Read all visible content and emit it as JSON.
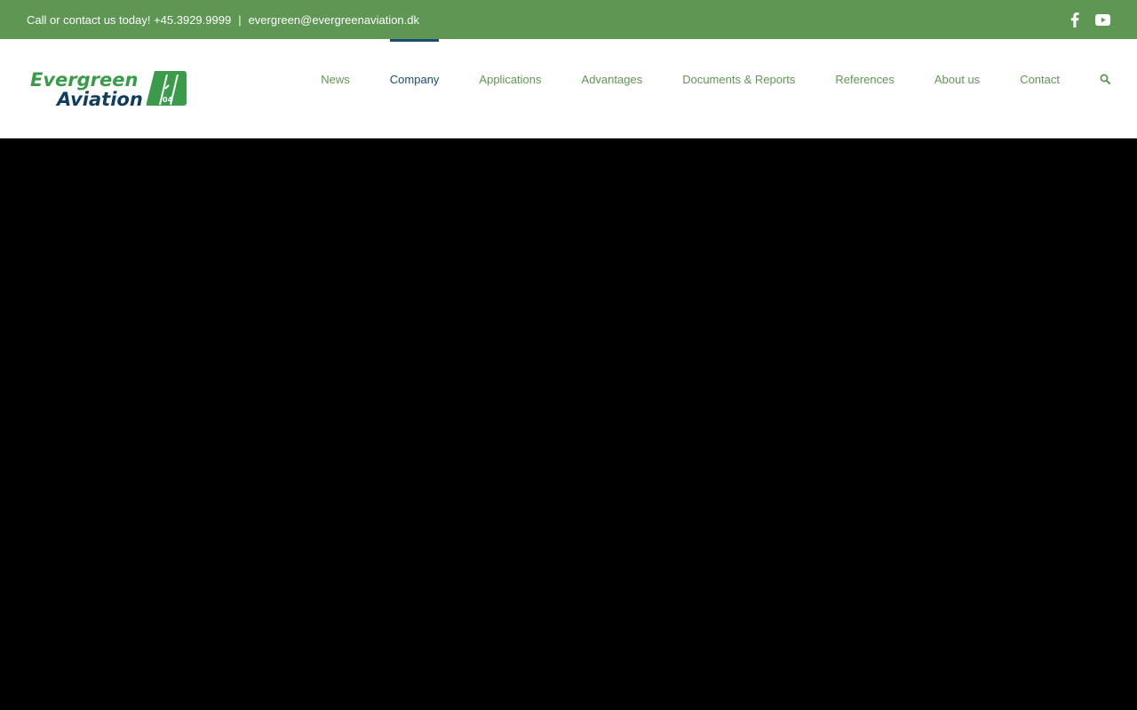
{
  "topbar": {
    "call_text": "Call or contact us today! +45.3929.9999",
    "separator": "|",
    "email": "evergreen@evergreenaviation.dk",
    "social": [
      {
        "icon": "facebook-icon"
      },
      {
        "icon": "youtube-icon"
      }
    ],
    "bg_color": "#5e9653"
  },
  "logo": {
    "line1": "Evergreen",
    "line2": "Aviation",
    "badge": "04",
    "colors": {
      "green": "#3a9c4a",
      "navy": "#0f3d5e"
    }
  },
  "nav": {
    "items": [
      {
        "label": "News",
        "active": false
      },
      {
        "label": "Company",
        "active": true
      },
      {
        "label": "Applications",
        "active": false
      },
      {
        "label": "Advantages",
        "active": false
      },
      {
        "label": "Documents & Reports",
        "active": false
      },
      {
        "label": "References",
        "active": false
      },
      {
        "label": "About us",
        "active": false
      },
      {
        "label": "Contact",
        "active": false
      }
    ],
    "search_icon": "search-icon",
    "link_color": "#5e9653",
    "active_color": "#1a4d6e"
  },
  "hero": {
    "bg_color": "#000000"
  }
}
